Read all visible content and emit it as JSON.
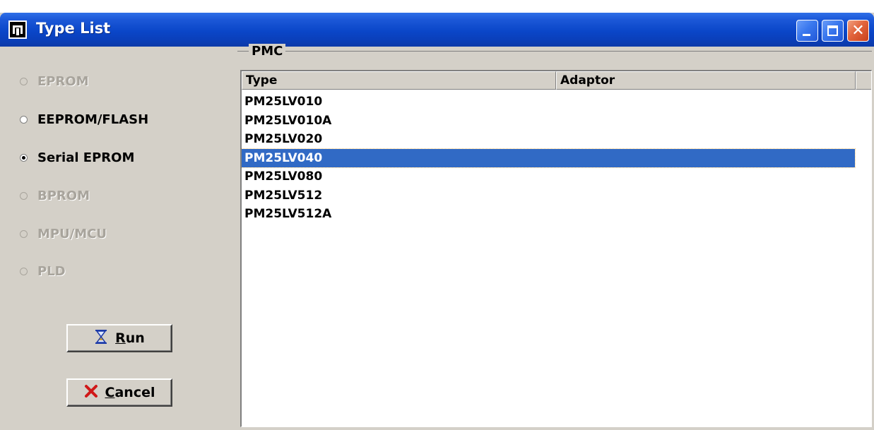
{
  "window": {
    "title": "Type List"
  },
  "left": {
    "radios": [
      {
        "label": "EPROM",
        "enabled": false,
        "selected": false
      },
      {
        "label": "EEPROM/FLASH",
        "enabled": true,
        "selected": false
      },
      {
        "label": "Serial EPROM",
        "enabled": true,
        "selected": true
      },
      {
        "label": "BPROM",
        "enabled": false,
        "selected": false
      },
      {
        "label": "MPU/MCU",
        "enabled": false,
        "selected": false
      },
      {
        "label": "PLD",
        "enabled": false,
        "selected": false
      }
    ],
    "run_label_mnemonic": "R",
    "run_label_rest": "un",
    "cancel_label_mnemonic": "C",
    "cancel_label_rest": "ancel"
  },
  "group": {
    "label": "PMC",
    "columns": [
      "Type",
      "Adaptor"
    ],
    "rows": [
      {
        "type": "PM25LV010",
        "adaptor": ""
      },
      {
        "type": "PM25LV010A",
        "adaptor": ""
      },
      {
        "type": "PM25LV020",
        "adaptor": ""
      },
      {
        "type": "PM25LV040",
        "adaptor": ""
      },
      {
        "type": "PM25LV080",
        "adaptor": ""
      },
      {
        "type": "PM25LV512",
        "adaptor": ""
      },
      {
        "type": "PM25LV512A",
        "adaptor": ""
      }
    ],
    "selected_type": "PM25LV040"
  },
  "colors": {
    "titlebar": "#0a46c8",
    "selection": "#316ac5",
    "face": "#d4d0c8"
  },
  "icons": {
    "app": "app-logo-icon",
    "run": "hourglass-icon",
    "cancel": "red-x-icon"
  }
}
